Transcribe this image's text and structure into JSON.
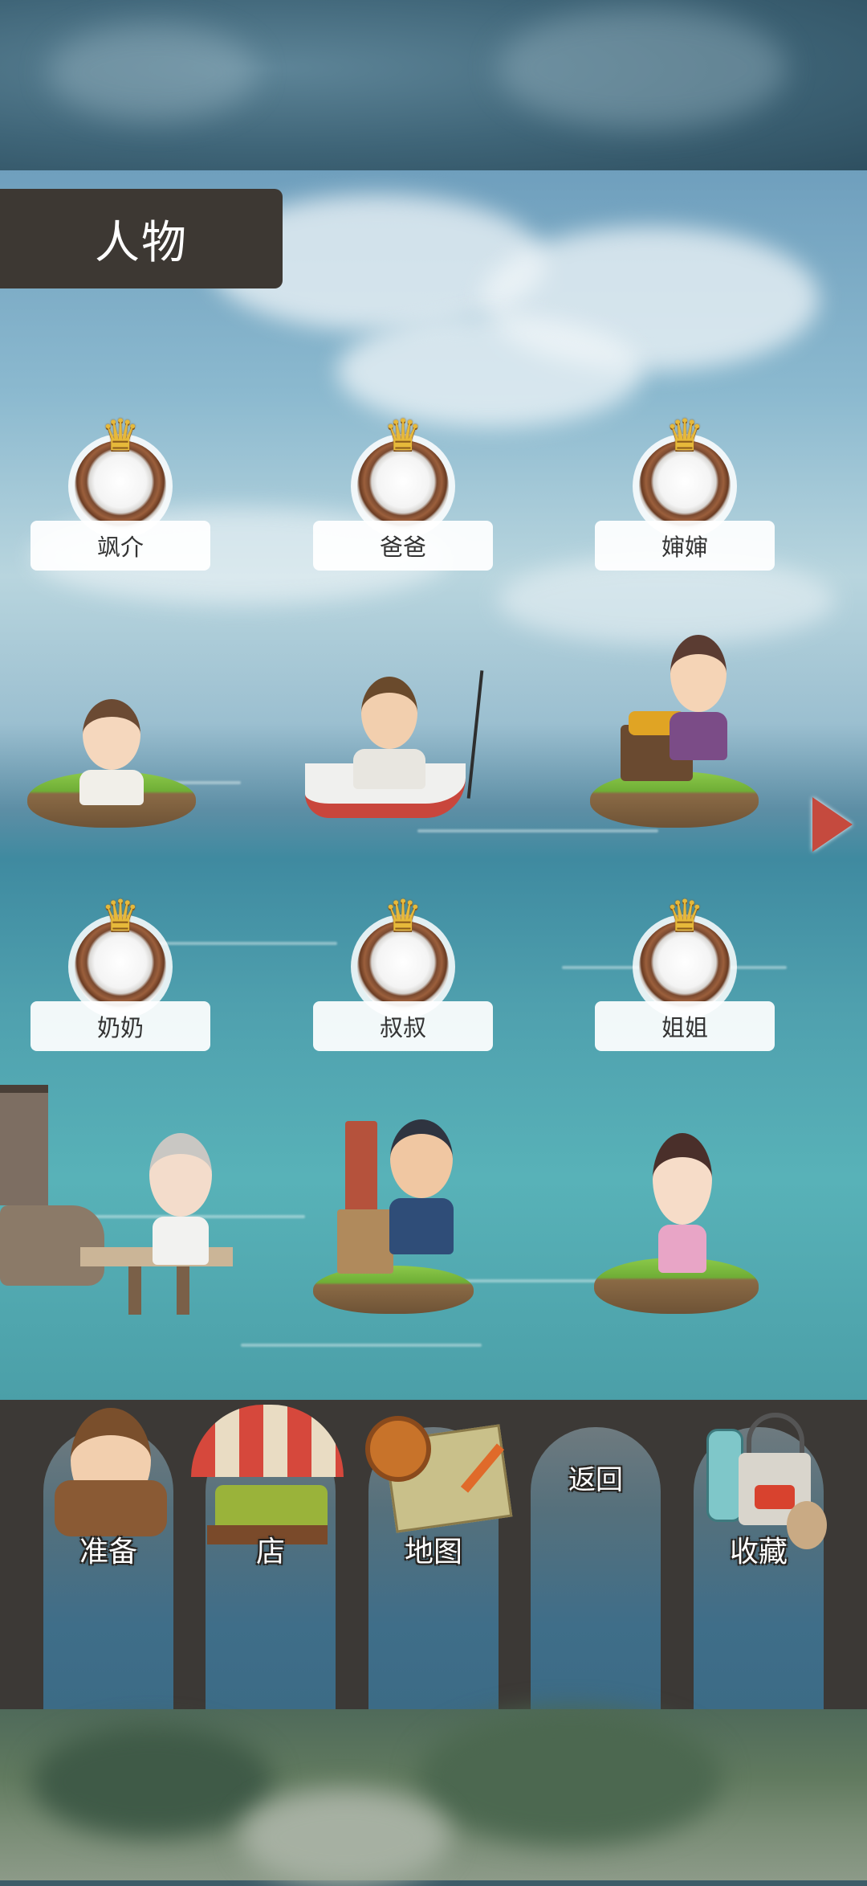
{
  "header": {
    "title": "人物"
  },
  "characters": [
    {
      "name": "飒介"
    },
    {
      "name": "爸爸"
    },
    {
      "name": "婶婶"
    },
    {
      "name": "奶奶"
    },
    {
      "name": "叔叔"
    },
    {
      "name": "姐姐"
    }
  ],
  "nav": {
    "prepare": "准备",
    "shop": "店",
    "map": "地图",
    "back": "返回",
    "collection": "收藏"
  },
  "icons": {
    "next": "next-page-arrow-icon",
    "badge": "crown-medal-icon"
  },
  "colors": {
    "title_bg": "#3d3833",
    "nav_bar": "#3c3936",
    "arrow": "#c54a3e",
    "star": "#e6b93a"
  }
}
